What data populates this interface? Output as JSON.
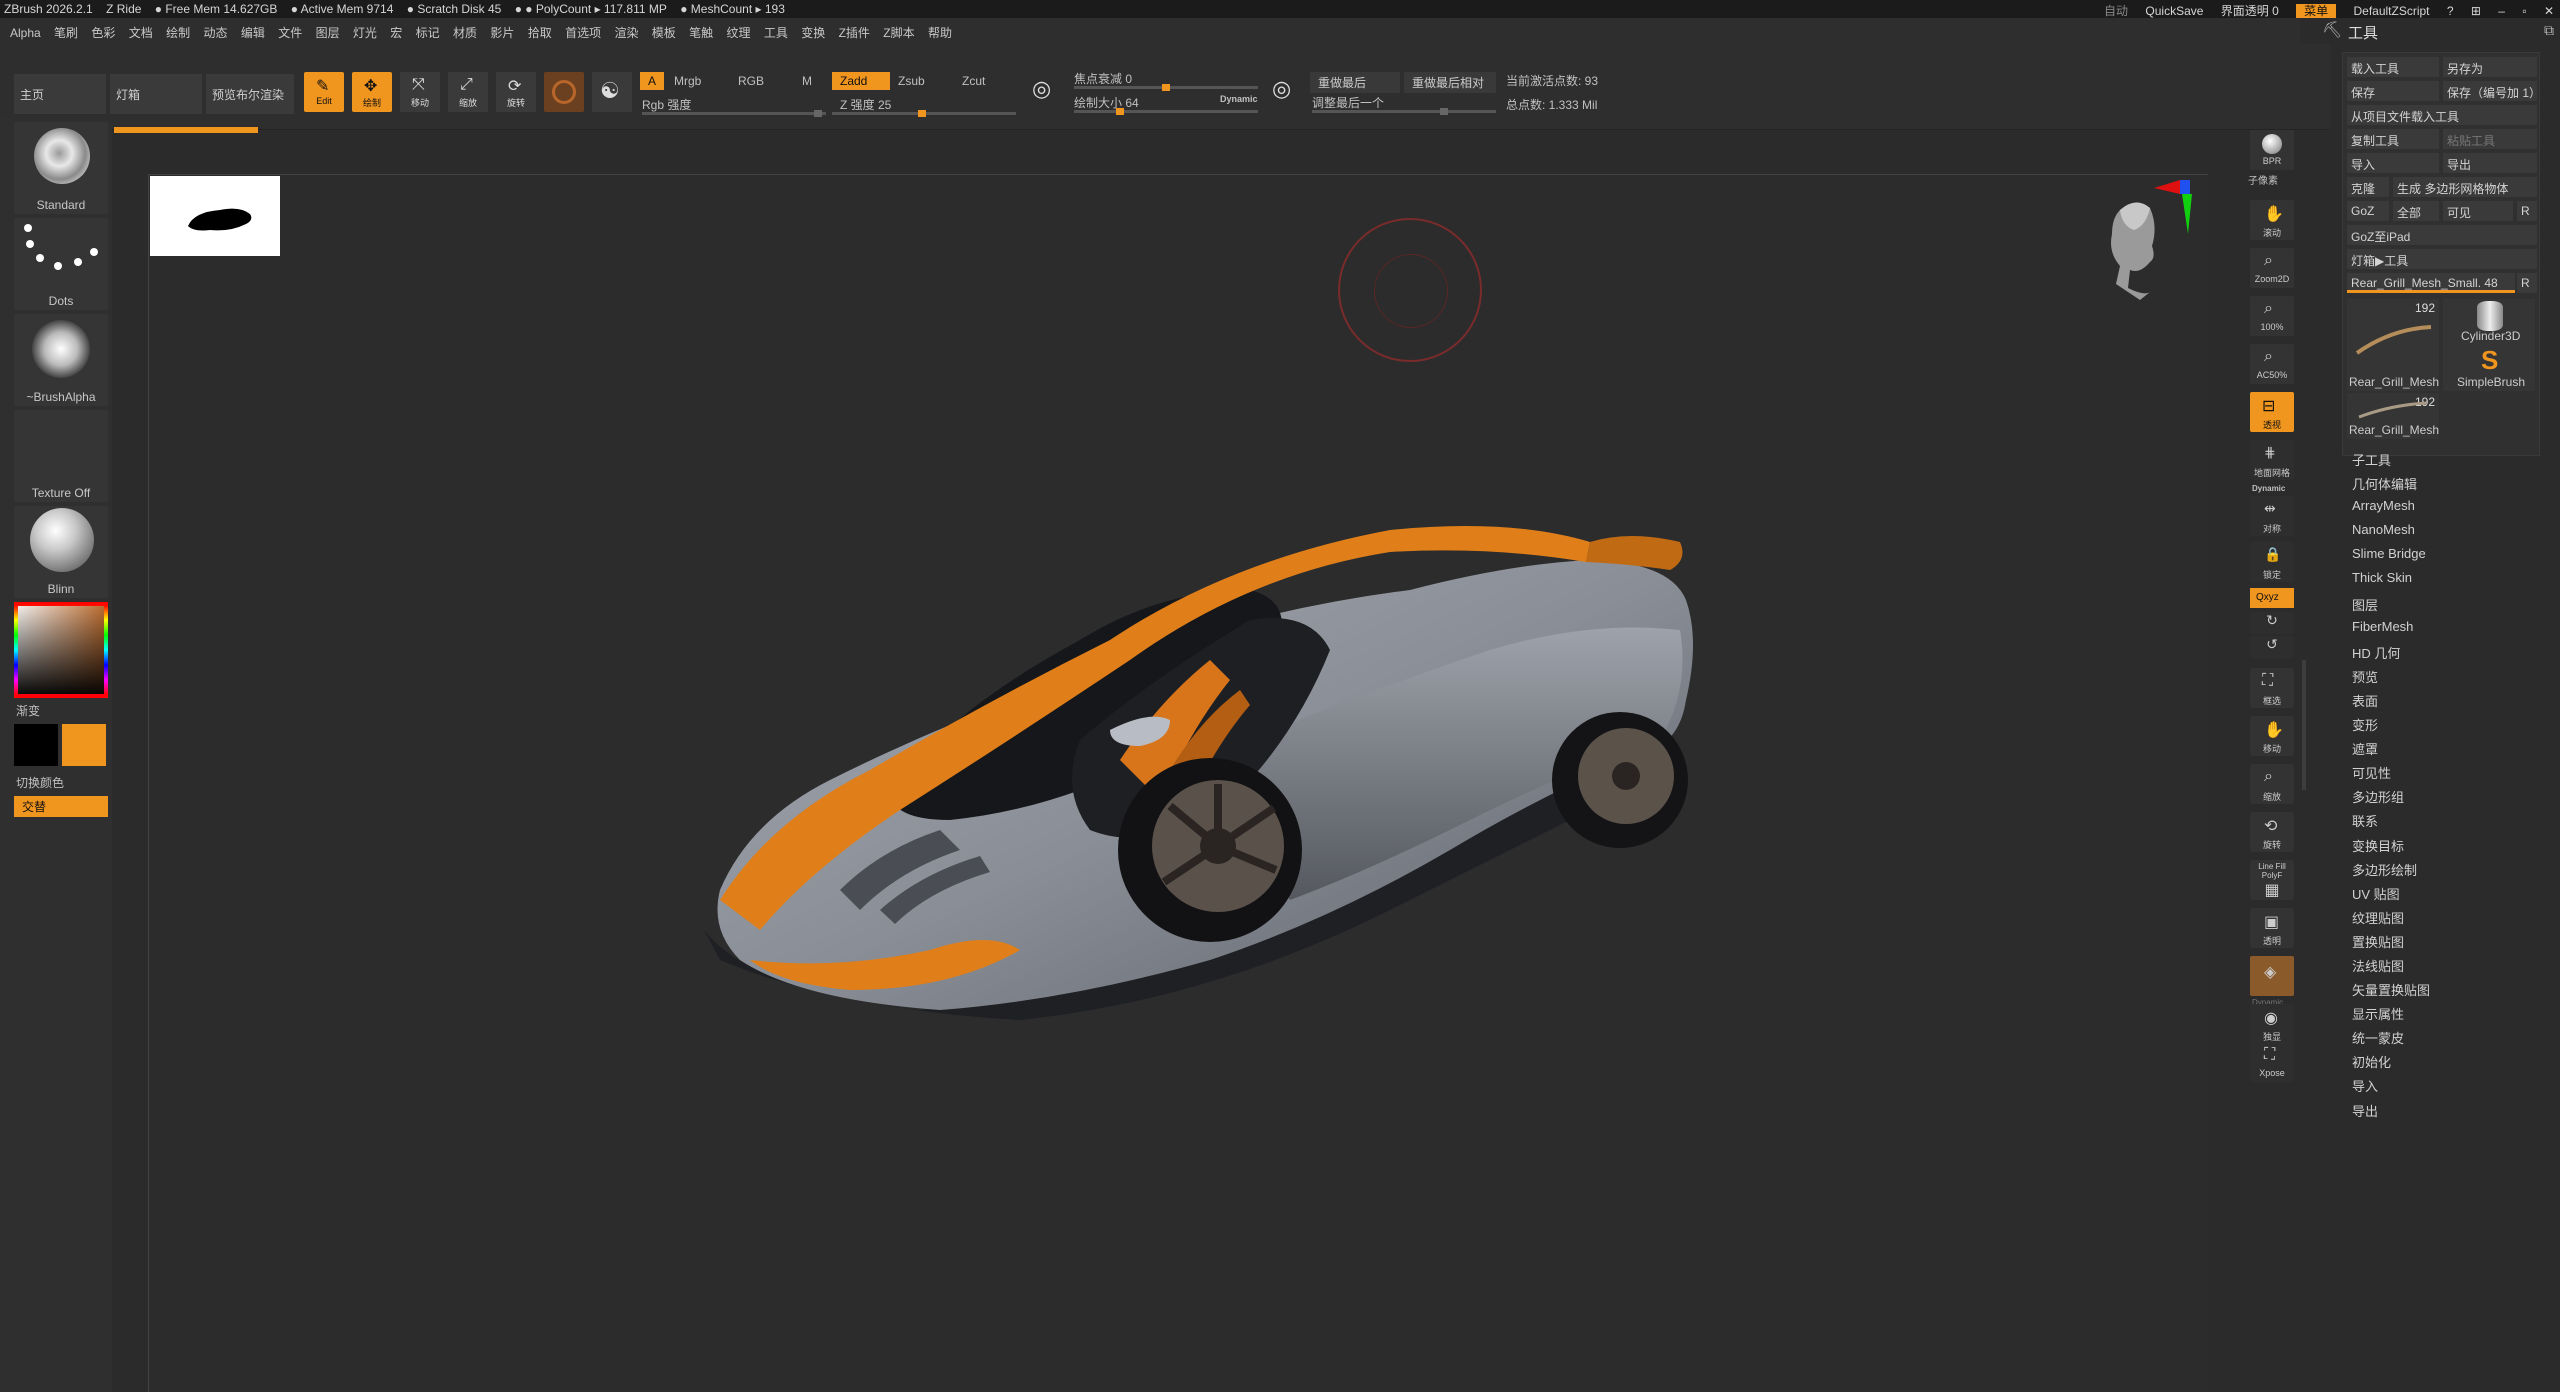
{
  "titlebar": {
    "app": "ZBrush 2026.2.1",
    "ride": "Z Ride",
    "free_mem": "● Free Mem 14.627GB",
    "active_mem": "● Active Mem 9714",
    "scratch": "● Scratch Disk 45",
    "polycount": "● ● PolyCount ▸ 117.811 MP",
    "meshcount": "● MeshCount ▸ 193",
    "auto": "自动",
    "quicksave": "QuickSave",
    "transparency": "界面透明 0",
    "menu": "菜单",
    "script": "DefaultZScript"
  },
  "menu": [
    "Alpha",
    "笔刷",
    "色彩",
    "文档",
    "绘制",
    "动态",
    "编辑",
    "文件",
    "图层",
    "灯光",
    "宏",
    "标记",
    "材质",
    "影片",
    "拾取",
    "首选项",
    "渲染",
    "模板",
    "笔触",
    "纹理",
    "工具",
    "变换",
    "Z插件",
    "Z脚本",
    "帮助"
  ],
  "toolbar": {
    "home": "主页",
    "lightbox": "灯箱",
    "bpr": "预览布尔渲染",
    "edit": "Edit",
    "draw": "绘制",
    "move": "移动",
    "scale": "缩放",
    "rotate": "旋转",
    "a": "A",
    "mrgb": "Mrgb",
    "rgb": "RGB",
    "m": "M",
    "rgb_intensity": "Rgb 强度",
    "zadd": "Zadd",
    "zsub": "Zsub",
    "zcut": "Zcut",
    "z_intensity": "Z 强度 25",
    "focal_shift": "焦点衰减 0",
    "draw_size": "绘制大小 64",
    "dynamic": "Dynamic",
    "replay_last": "重做最后",
    "replay_last_rel": "重做最后相对",
    "adjust_last": "调整最后一个",
    "active_points": "当前激活点数: 93",
    "total_points": "总点数: 1.333 Mil"
  },
  "left": {
    "brush": "Standard",
    "stroke": "Dots",
    "alpha": "~BrushAlpha",
    "texture": "Texture Off",
    "material": "Blinn",
    "gradient": "渐变",
    "switch_color": "切换颜色",
    "alternate": "交替"
  },
  "rstrip": [
    "BPR",
    "子像素",
    "滚动",
    "Zoom2D",
    "100%",
    "AC50%",
    "透视",
    "地面网格",
    "Dynamic",
    "对称",
    "锁定",
    "Qxyz",
    "",
    "",
    "框选",
    "移动",
    "缩放",
    "旋转",
    "Line Fill PolyF",
    "透明",
    "",
    "Dynamic",
    "独显",
    "Xpose"
  ],
  "panel": {
    "title": "工具",
    "load_tool": "载入工具",
    "save_as": "另存为",
    "save": "保存",
    "save_inc": "保存（编号加 1）",
    "load_from_project": "从项目文件载入工具",
    "copy_tool": "复制工具",
    "paste_tool": "粘贴工具",
    "import": "导入",
    "export": "导出",
    "clone": "克隆",
    "make_polymesh": "生成 多边形网格物体",
    "goz": "GoZ",
    "all": "全部",
    "visible": "可见",
    "r": "R",
    "goz_ipad": "GoZ至iPad",
    "lightbox_tools": "灯箱▶工具",
    "current_tool": "Rear_Grill_Mesh_Small. 48",
    "tile1_name": "Rear_Grill_Mesh",
    "tile1_num": "192",
    "tile2_name": "Cylinder3D",
    "tile3_name": "SimpleBrush",
    "tile4_name": "Rear_Grill_Mesh",
    "tile4_num": "192",
    "subpalettes": [
      "子工具",
      "几何体编辑",
      "ArrayMesh",
      "NanoMesh",
      "Slime Bridge",
      "Thick Skin",
      "图层",
      "FiberMesh",
      "HD 几何",
      "预览",
      "表面",
      "变形",
      "遮罩",
      "可见性",
      "多边形组",
      "联系",
      "变换目标",
      "多边形绘制",
      "UV 贴图",
      "纹理贴图",
      "置换贴图",
      "法线贴图",
      "矢量置换贴图",
      "显示属性",
      "统一蒙皮",
      "初始化",
      "导入",
      "导出"
    ]
  },
  "colors": {
    "accent": "#f0951e",
    "bg": "#2b2b2b",
    "car_orange": "#e07f1a",
    "car_body": "#8a8e96"
  },
  "status": {
    "progress": 0.5
  }
}
